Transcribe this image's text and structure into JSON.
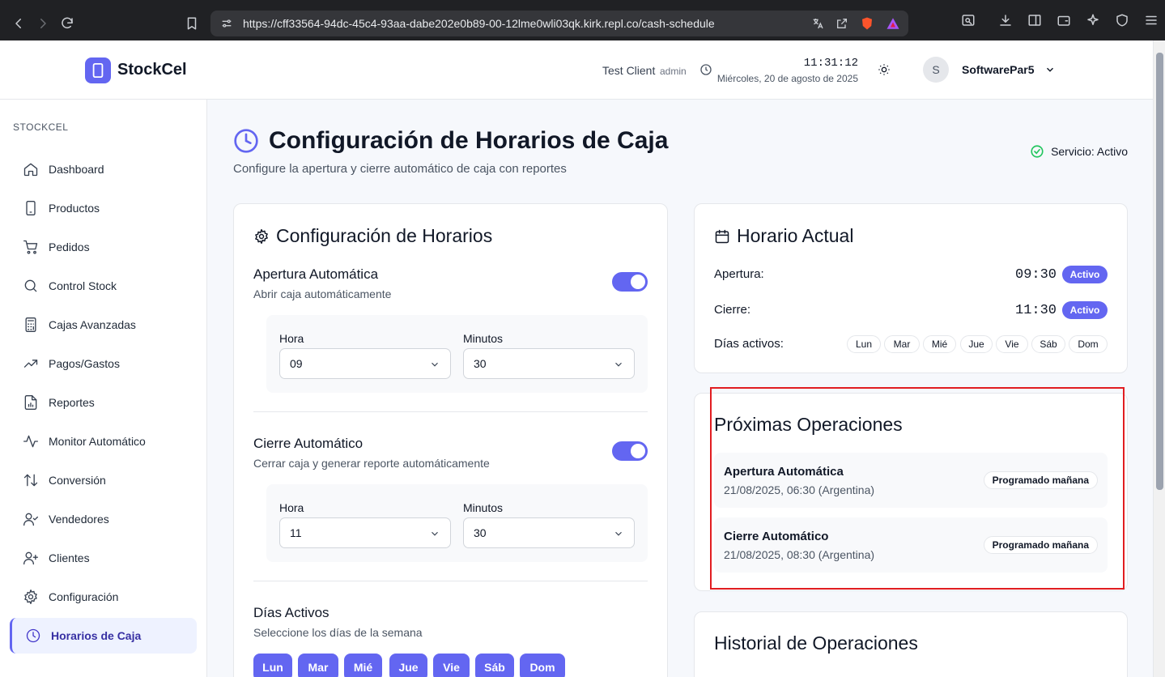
{
  "browser": {
    "url": "https://cff33564-94dc-45c4-93aa-dabe202e0b89-00-12lme0wli03qk.kirk.repl.co/cash-schedule"
  },
  "header": {
    "brand": "StockCel",
    "client": "Test Client",
    "role": "admin",
    "time": "11:31:12",
    "date": "Miércoles, 20 de agosto de 2025",
    "avatar_letter": "S",
    "username": "SoftwarePar5"
  },
  "sidebar": {
    "title": "STOCKCEL",
    "items": [
      {
        "label": "Dashboard",
        "icon": "home-icon"
      },
      {
        "label": "Productos",
        "icon": "phone-icon"
      },
      {
        "label": "Pedidos",
        "icon": "cart-icon"
      },
      {
        "label": "Control Stock",
        "icon": "search-icon"
      },
      {
        "label": "Cajas Avanzadas",
        "icon": "calculator-icon"
      },
      {
        "label": "Pagos/Gastos",
        "icon": "trending-up-icon"
      },
      {
        "label": "Reportes",
        "icon": "report-icon"
      },
      {
        "label": "Monitor Automático",
        "icon": "activity-icon"
      },
      {
        "label": "Conversión",
        "icon": "arrows-icon"
      },
      {
        "label": "Vendedores",
        "icon": "user-check-icon"
      },
      {
        "label": "Clientes",
        "icon": "user-plus-icon"
      },
      {
        "label": "Configuración",
        "icon": "gear-icon"
      },
      {
        "label": "Horarios de Caja",
        "icon": "clock-icon"
      }
    ]
  },
  "page": {
    "title": "Configuración de Horarios de Caja",
    "subtitle": "Configure la apertura y cierre automático de caja con reportes",
    "service_status": "Servicio: Activo"
  },
  "config": {
    "title": "Configuración de Horarios",
    "opening": {
      "title": "Apertura Automática",
      "subtitle": "Abrir caja automáticamente",
      "enabled": true,
      "hour_label": "Hora",
      "hour": "09",
      "minute_label": "Minutos",
      "minute": "30"
    },
    "closing": {
      "title": "Cierre Automático",
      "subtitle": "Cerrar caja y generar reporte automáticamente",
      "enabled": true,
      "hour_label": "Hora",
      "hour": "11",
      "minute_label": "Minutos",
      "minute": "30"
    },
    "days": {
      "title": "Días Activos",
      "subtitle": "Seleccione los días de la semana",
      "items": [
        "Lun",
        "Mar",
        "Mié",
        "Jue",
        "Vie",
        "Sáb",
        "Dom"
      ]
    }
  },
  "current": {
    "title": "Horario Actual",
    "opening_label": "Apertura:",
    "opening_time": "09:30",
    "opening_status": "Activo",
    "closing_label": "Cierre:",
    "closing_time": "11:30",
    "closing_status": "Activo",
    "days_label": "Días activos:",
    "days": [
      "Lun",
      "Mar",
      "Mié",
      "Jue",
      "Vie",
      "Sáb",
      "Dom"
    ]
  },
  "upcoming": {
    "title": "Próximas Operaciones",
    "ops": [
      {
        "title": "Apertura Automática",
        "when": "21/08/2025, 06:30 (Argentina)",
        "status": "Programado mañana"
      },
      {
        "title": "Cierre Automático",
        "when": "21/08/2025, 08:30 (Argentina)",
        "status": "Programado mañana"
      }
    ]
  },
  "history": {
    "title": "Historial de Operaciones"
  },
  "colors": {
    "accent": "#6366f1",
    "highlight": "#e11d21",
    "success": "#22c55e"
  }
}
